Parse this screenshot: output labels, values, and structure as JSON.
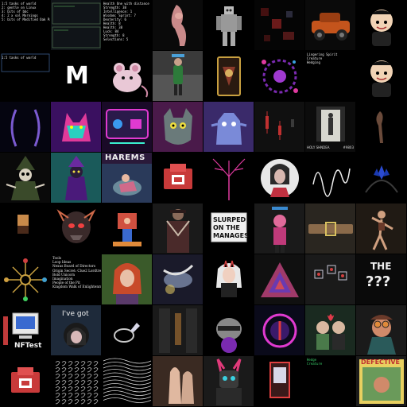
{
  "tiles": [
    {
      "id": "r0c0",
      "bg": "#000000",
      "kind": "text-list",
      "lines": [
        "1:5 tasks of world",
        "2: gentle on Linux",
        "3: bits of bbc",
        "4: 2 x sol Mornings",
        "5: bits of Modified Oak Paper"
      ]
    },
    {
      "id": "r0c1",
      "bg": "#101418",
      "kind": "terminal",
      "lines": []
    },
    {
      "id": "r0c2",
      "bg": "#000000",
      "kind": "text-list",
      "lines": [
        "Health One with distance",
        "Strength: 38",
        "Intelligence: 1",
        "Wisdom: Sprint: 7",
        "Dexterity: 6",
        "Health: 8",
        "Health: 38",
        "Luck: 84",
        "Strength: 8",
        "Selections: 5"
      ]
    },
    {
      "id": "r0c3",
      "bg": "#0a0a0a",
      "kind": "art",
      "motif": "figure-pink"
    },
    {
      "id": "r0c4",
      "bg": "#000000",
      "kind": "art",
      "motif": "robot-grey"
    },
    {
      "id": "r0c5",
      "bg": "#050505",
      "kind": "art",
      "motif": "pixel-dark-red"
    },
    {
      "id": "r0c6",
      "bg": "#0a0a0a",
      "kind": "art",
      "motif": "orange-car"
    },
    {
      "id": "r0c7",
      "bg": "#000000",
      "kind": "art",
      "motif": "chibi-dark"
    },
    {
      "id": "r1c0",
      "bg": "#000000",
      "kind": "terminal-blue",
      "lines": [
        "1:5 tasks of world"
      ]
    },
    {
      "id": "r1c1",
      "bg": "#000000",
      "kind": "letter",
      "text": "M",
      "color": "#ffffff"
    },
    {
      "id": "r1c2",
      "bg": "#000000",
      "kind": "art",
      "motif": "pink-rat"
    },
    {
      "id": "r1c3",
      "bg": "#2a2a2a",
      "kind": "art",
      "motif": "green-figure-room"
    },
    {
      "id": "r1c4",
      "bg": "#000000",
      "kind": "art",
      "motif": "gold-card"
    },
    {
      "id": "r1c5",
      "bg": "#000000",
      "kind": "art",
      "motif": "purple-ornament"
    },
    {
      "id": "r1c6",
      "bg": "#000000",
      "kind": "text-list",
      "lines": [
        "",
        "",
        "Lingering Spirit",
        "Creature",
        "",
        "Hedging"
      ]
    },
    {
      "id": "r1c7",
      "bg": "#000000",
      "kind": "art",
      "motif": "chibi-dark"
    },
    {
      "id": "r2c0",
      "bg": "#050510",
      "kind": "art",
      "motif": "purple-arcs"
    },
    {
      "id": "r2c1",
      "bg": "#1b0b2a",
      "kind": "art",
      "motif": "neon-wolf"
    },
    {
      "id": "r2c2",
      "bg": "#1a0a28",
      "kind": "art",
      "motif": "neon-game"
    },
    {
      "id": "r2c3",
      "bg": "#4a1a4a",
      "kind": "art",
      "motif": "grey-cat"
    },
    {
      "id": "r2c4",
      "bg": "#3a2a6a",
      "kind": "art",
      "motif": "blue-creature"
    },
    {
      "id": "r2c5",
      "bg": "#101010",
      "kind": "art",
      "motif": "candle-chart"
    },
    {
      "id": "r2c6",
      "bg": "#0c0c0c",
      "kind": "art",
      "motif": "doorway",
      "caption_left": "HOLY SHNDEA",
      "caption_right": "#9803"
    },
    {
      "id": "r2c7",
      "bg": "#000000",
      "kind": "art",
      "motif": "thin-figure"
    },
    {
      "id": "r3c0",
      "bg": "#0a0a0a",
      "kind": "art",
      "motif": "skeleton-wizard"
    },
    {
      "id": "r3c1",
      "bg": "#1a5a5a",
      "kind": "art",
      "motif": "purple-mage"
    },
    {
      "id": "r3c2",
      "bg": "#2a1a3a",
      "kind": "art",
      "motif": "harems",
      "title": "HAREMS"
    },
    {
      "id": "r3c3",
      "bg": "#000000",
      "kind": "art",
      "motif": "red-box"
    },
    {
      "id": "r3c4",
      "bg": "#000000",
      "kind": "art",
      "motif": "pink-tree"
    },
    {
      "id": "r3c5",
      "bg": "#000000",
      "kind": "art",
      "motif": "woman-circle"
    },
    {
      "id": "r3c6",
      "bg": "#000000",
      "kind": "art",
      "motif": "white-wave"
    },
    {
      "id": "r3c7",
      "bg": "#000000",
      "kind": "art",
      "motif": "blue-hands"
    },
    {
      "id": "r4c0",
      "bg": "#000000",
      "kind": "art",
      "motif": "brown-block"
    },
    {
      "id": "r4c1",
      "bg": "#000000",
      "kind": "art",
      "motif": "alien-head"
    },
    {
      "id": "r4c2",
      "bg": "#000000",
      "kind": "art",
      "motif": "pixel-scene"
    },
    {
      "id": "r4c3",
      "bg": "#1a1a1a",
      "kind": "art",
      "motif": "jacket-figure"
    },
    {
      "id": "r4c4",
      "bg": "#000000",
      "kind": "art",
      "motif": "sign",
      "sign_lines": [
        "SLURPED",
        "ON THE",
        "MANAGES"
      ]
    },
    {
      "id": "r4c5",
      "bg": "#1a1a1a",
      "kind": "art",
      "motif": "pink-avatar"
    },
    {
      "id": "r4c6",
      "bg": "#2a2620",
      "kind": "art",
      "motif": "belt"
    },
    {
      "id": "r4c7",
      "bg": "#201a14",
      "kind": "art",
      "motif": "dancer"
    },
    {
      "id": "r5c0",
      "bg": "#000000",
      "kind": "art",
      "motif": "keys-wheel"
    },
    {
      "id": "r5c1",
      "bg": "#000000",
      "kind": "text-list",
      "style": "serif",
      "lines": [
        "Tools",
        "Loop Ideas",
        "Nexus Board of Directors",
        "Origin Secret: Clue2 Lordtree Bell of Promisione",
        "Bold Unicorn",
        "Imagination",
        "People of the Pit",
        "Kingdom Walk of Enlightenment"
      ]
    },
    {
      "id": "r5c2",
      "bg": "#1a2a18",
      "kind": "art",
      "motif": "redhead-portrait"
    },
    {
      "id": "r5c3",
      "bg": "#1a1a2a",
      "kind": "art",
      "motif": "blurry-bird"
    },
    {
      "id": "r5c4",
      "bg": "#000000",
      "kind": "art",
      "motif": "anime-girl"
    },
    {
      "id": "r5c5",
      "bg": "#101010",
      "kind": "art",
      "motif": "triangle"
    },
    {
      "id": "r5c6",
      "bg": "#1a1a1a",
      "kind": "art",
      "motif": "glass-cubes"
    },
    {
      "id": "r5c7",
      "bg": "#0a0a0a",
      "kind": "art",
      "motif": "question",
      "headline": "THE",
      "mark": "???"
    },
    {
      "id": "r6c0",
      "bg": "#000000",
      "kind": "art",
      "motif": "computer",
      "caption": "NFTest"
    },
    {
      "id": "r6c1",
      "bg": "#1e2a3a",
      "kind": "art",
      "motif": "ive-got",
      "caption": "I've got"
    },
    {
      "id": "r6c2",
      "bg": "#000000",
      "kind": "art",
      "motif": "ring"
    },
    {
      "id": "r6c3",
      "bg": "#1a1a1a",
      "kind": "art",
      "motif": "dark-alley"
    },
    {
      "id": "r6c4",
      "bg": "#000000",
      "kind": "art",
      "motif": "helmet-creature"
    },
    {
      "id": "r6c5",
      "bg": "#0a0a1a",
      "kind": "art",
      "motif": "neon-portal"
    },
    {
      "id": "r6c6",
      "bg": "#1a2a20",
      "kind": "art",
      "motif": "old-couple"
    },
    {
      "id": "r6c7",
      "bg": "#1a1a1a",
      "kind": "art",
      "motif": "goggles-man"
    },
    {
      "id": "r7c0",
      "bg": "#000000",
      "kind": "art",
      "motif": "red-box"
    },
    {
      "id": "r7c1",
      "bg": "#000000",
      "kind": "art",
      "motif": "glyph-grid"
    },
    {
      "id": "r7c2",
      "bg": "#000000",
      "kind": "art",
      "motif": "wavy-lines"
    },
    {
      "id": "r7c3",
      "bg": "#3a2a22",
      "kind": "art",
      "motif": "bodies"
    },
    {
      "id": "r7c4",
      "bg": "#1a1a1a",
      "kind": "art",
      "motif": "bunny-mech"
    },
    {
      "id": "r7c5",
      "bg": "#000000",
      "kind": "art",
      "motif": "red-card"
    },
    {
      "id": "r7c6",
      "bg": "#000000",
      "kind": "art",
      "motif": "small-text",
      "lines": [
        "",
        "",
        "",
        "",
        "",
        "",
        "",
        "",
        "",
        "Hedge",
        "Creature"
      ]
    },
    {
      "id": "r7c7",
      "bg": "#1a1a1a",
      "kind": "art",
      "motif": "defective",
      "headline": "DEFECTIVE"
    }
  ]
}
